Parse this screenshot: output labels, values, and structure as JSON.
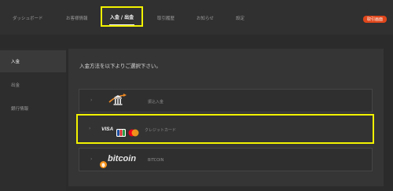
{
  "nav": {
    "items": [
      "ダッシュボード",
      "お客様情報",
      "入金 / 出金",
      "取引履歴",
      "お知らせ",
      "設定"
    ],
    "trade_button": "取引画面"
  },
  "sidebar": {
    "items": [
      "入金",
      "出金",
      "銀行情報"
    ]
  },
  "main": {
    "instruction": "入金方法を以下よりご選択下さい。",
    "methods": [
      {
        "label": "振込入金",
        "icon": "bank-icon"
      },
      {
        "label": "クレジットカード",
        "icon": "credit-card-brands-icon",
        "brand_text": "VISA"
      },
      {
        "label": "BITCOIN",
        "icon": "bitcoin-icon",
        "brand_text": "bitcoin"
      }
    ]
  },
  "colors": {
    "highlight": "#f2f200",
    "trade_button": "#e0461b",
    "bitcoin": "#f7931a",
    "mastercard_red": "#eb001b",
    "mastercard_orange": "#f79e1b",
    "jcb_blue": "#1a4fa0"
  }
}
